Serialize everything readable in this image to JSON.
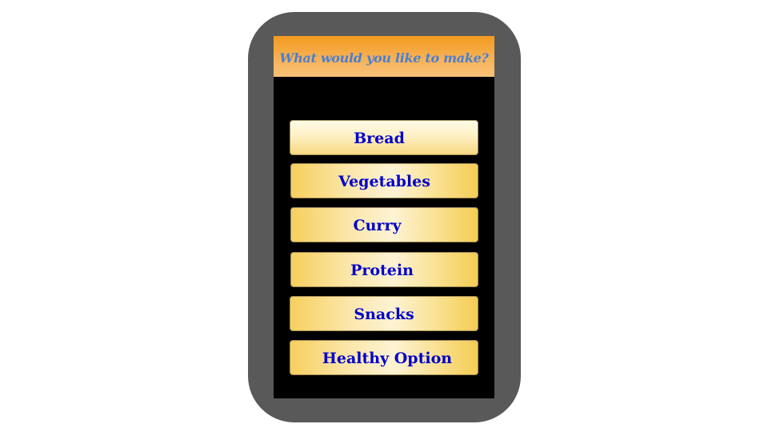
{
  "screen": {
    "title": "What would you like to make?"
  },
  "menu": {
    "items": [
      {
        "label": "Bread"
      },
      {
        "label": "Vegetables"
      },
      {
        "label": "Curry"
      },
      {
        "label": "Protein"
      },
      {
        "label": "Snacks"
      },
      {
        "label": "Healthy Option"
      }
    ]
  },
  "colors": {
    "frame": "#595959",
    "screen_background": "#000000",
    "header": "#f39a1e",
    "title_text": "#4a7fd1",
    "button_text": "#0000cc",
    "button_fill": "#f6cf5e"
  }
}
